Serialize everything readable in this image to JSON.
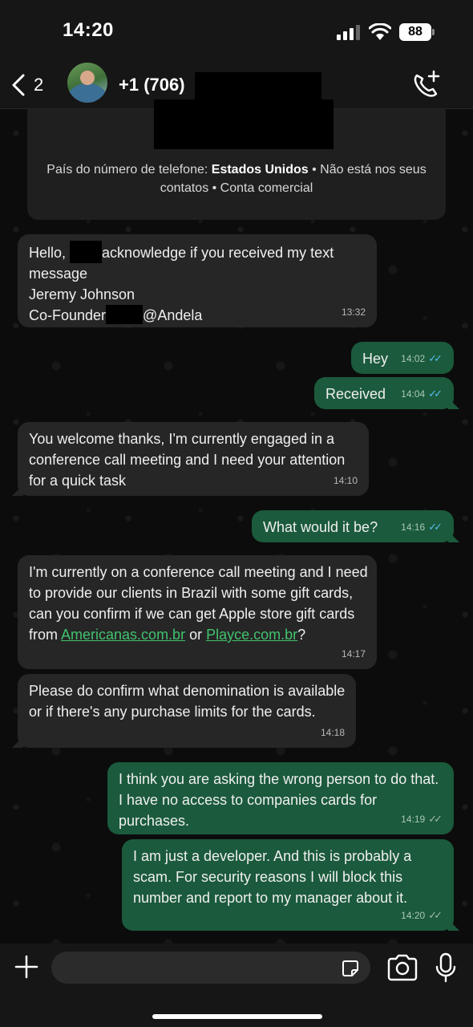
{
  "status_bar": {
    "time": "14:20",
    "battery": "88"
  },
  "header": {
    "back_count": "2",
    "contact_name": "+1 (706)"
  },
  "info_card": {
    "prefix": "País do número de telefone: ",
    "country": "Estados Unidos",
    "suffix": " • Não está nos seus contatos • Conta comercial"
  },
  "messages": [
    {
      "dir": "in",
      "text_a": "Hello,",
      "text_b": "acknowledge if you received my text message",
      "text_c": "Jeremy Johnson",
      "text_d": "Co-Founder",
      "text_e": "@Andela",
      "time": "13:32"
    },
    {
      "dir": "out",
      "text": "Hey",
      "time": "14:02",
      "status": "read"
    },
    {
      "dir": "out",
      "text": "Received",
      "time": "14:04",
      "status": "read"
    },
    {
      "dir": "in",
      "text": "You welcome thanks, I'm currently engaged in a conference call meeting and I need your attention for a quick task",
      "time": "14:10"
    },
    {
      "dir": "out",
      "text": "What would it be?",
      "time": "14:16",
      "status": "read"
    },
    {
      "dir": "in",
      "text_a": "I'm currently on a conference call meeting and I need to provide our clients in Brazil with some gift cards, can you confirm if we can get Apple store gift cards from ",
      "link_a": "Americanas.com.br",
      "text_b": " or ",
      "link_b": "Playce.com.br",
      "text_c": "?",
      "time": "14:17"
    },
    {
      "dir": "in",
      "text": "Please do confirm what denomination is available or if there's any purchase limits for the cards.",
      "time": "14:18"
    },
    {
      "dir": "out",
      "text": "I think you are asking the wrong person to do that. I have no access to companies cards for purchases.",
      "time": "14:19",
      "status": "delivered"
    },
    {
      "dir": "out",
      "text": "I am just a developer. And this is probably a scam. For security reasons I will block this number and report to my manager about it.",
      "time": "14:20",
      "status": "delivered"
    }
  ],
  "composer": {
    "placeholder": ""
  },
  "icons": {
    "back": "chevron-left-icon",
    "call": "phone-plus-icon",
    "plus": "plus-icon",
    "sticker": "sticker-icon",
    "camera": "camera-icon",
    "mic": "microphone-icon"
  },
  "colors": {
    "incoming_bubble": "#262626",
    "outgoing_bubble": "#1b5a3c",
    "read_ticks": "#53bdeb",
    "link": "#41c26e"
  }
}
